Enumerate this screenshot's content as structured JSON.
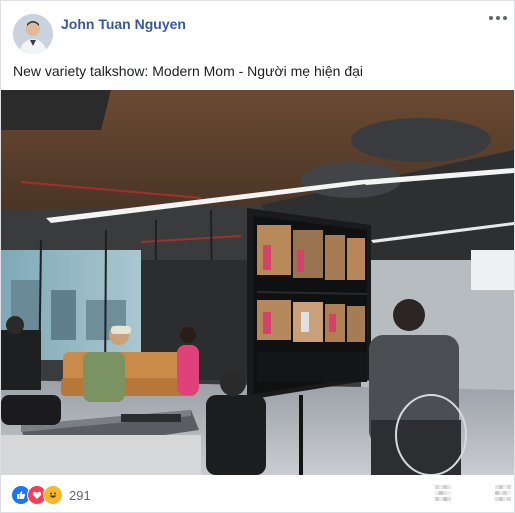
{
  "post": {
    "author": "John Tuan Nguyen",
    "text": "New variety talkshow: Modern Mom - Người mẹ hiện đại",
    "more_icon": "ellipsis-icon"
  },
  "reactions": {
    "icons": [
      "like-icon",
      "love-icon",
      "haha-icon"
    ],
    "count": "291",
    "colors": {
      "like": "#1877f2",
      "love": "#f33e58",
      "haha": "#f7b928"
    }
  }
}
